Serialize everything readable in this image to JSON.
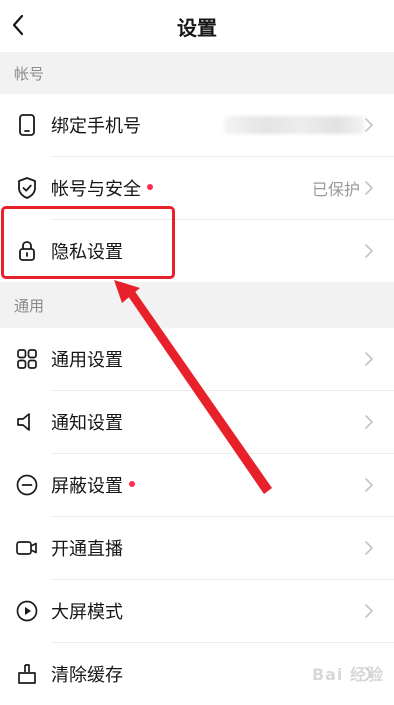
{
  "header": {
    "title": "设置"
  },
  "sections": {
    "account": "帐号",
    "general": "通用"
  },
  "rows": {
    "bind_phone": {
      "label": "绑定手机号"
    },
    "account_security": {
      "label": "帐号与安全",
      "value": "已保护"
    },
    "privacy": {
      "label": "隐私设置"
    },
    "general_settings": {
      "label": "通用设置"
    },
    "notification": {
      "label": "通知设置"
    },
    "block": {
      "label": "屏蔽设置"
    },
    "live": {
      "label": "开通直播"
    },
    "big_screen": {
      "label": "大屏模式"
    },
    "clear_cache": {
      "label": "清除缓存"
    }
  },
  "watermark": "Bai 经验",
  "colors": {
    "accent_dot": "#fe2c55",
    "annotation": "#e8202a",
    "section_bg": "#f2f2f2"
  },
  "icons": {
    "back": "chevron-left-icon",
    "bind_phone": "phone-icon",
    "account_security": "shield-check-icon",
    "privacy": "lock-icon",
    "general_settings": "grid-icon",
    "notification": "speaker-icon",
    "block": "minus-circle-icon",
    "live": "video-camera-icon",
    "big_screen": "play-circle-icon",
    "clear_cache": "broom-icon",
    "chevron": "chevron-right-icon"
  }
}
